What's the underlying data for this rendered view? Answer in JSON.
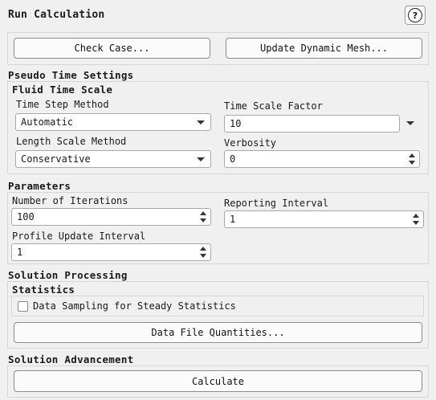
{
  "panel": {
    "title": "Run Calculation",
    "help_icon": "question-circle-icon",
    "help_glyph": "?"
  },
  "top_buttons": {
    "check_case": "Check Case...",
    "update_mesh": "Update Dynamic Mesh..."
  },
  "pseudo_time": {
    "heading": "Pseudo Time Settings",
    "subheading": "Fluid Time Scale",
    "time_step_method": {
      "label": "Time Step Method",
      "value": "Automatic"
    },
    "length_scale_method": {
      "label": "Length Scale Method",
      "value": "Conservative"
    },
    "time_scale_factor": {
      "label": "Time Scale Factor",
      "value": "10"
    },
    "verbosity": {
      "label": "Verbosity",
      "value": "0"
    }
  },
  "parameters": {
    "heading": "Parameters",
    "iterations": {
      "label": "Number of Iterations",
      "value": "100"
    },
    "reporting_interval": {
      "label": "Reporting Interval",
      "value": "1"
    },
    "profile_update": {
      "label": "Profile Update Interval",
      "value": "1"
    }
  },
  "solution_processing": {
    "heading": "Solution Processing",
    "statistics_heading": "Statistics",
    "data_sampling": {
      "label": "Data Sampling for Steady Statistics",
      "checked": false
    },
    "data_file_button": "Data File Quantities..."
  },
  "solution_advancement": {
    "heading": "Solution Advancement",
    "calculate_button": "Calculate"
  }
}
